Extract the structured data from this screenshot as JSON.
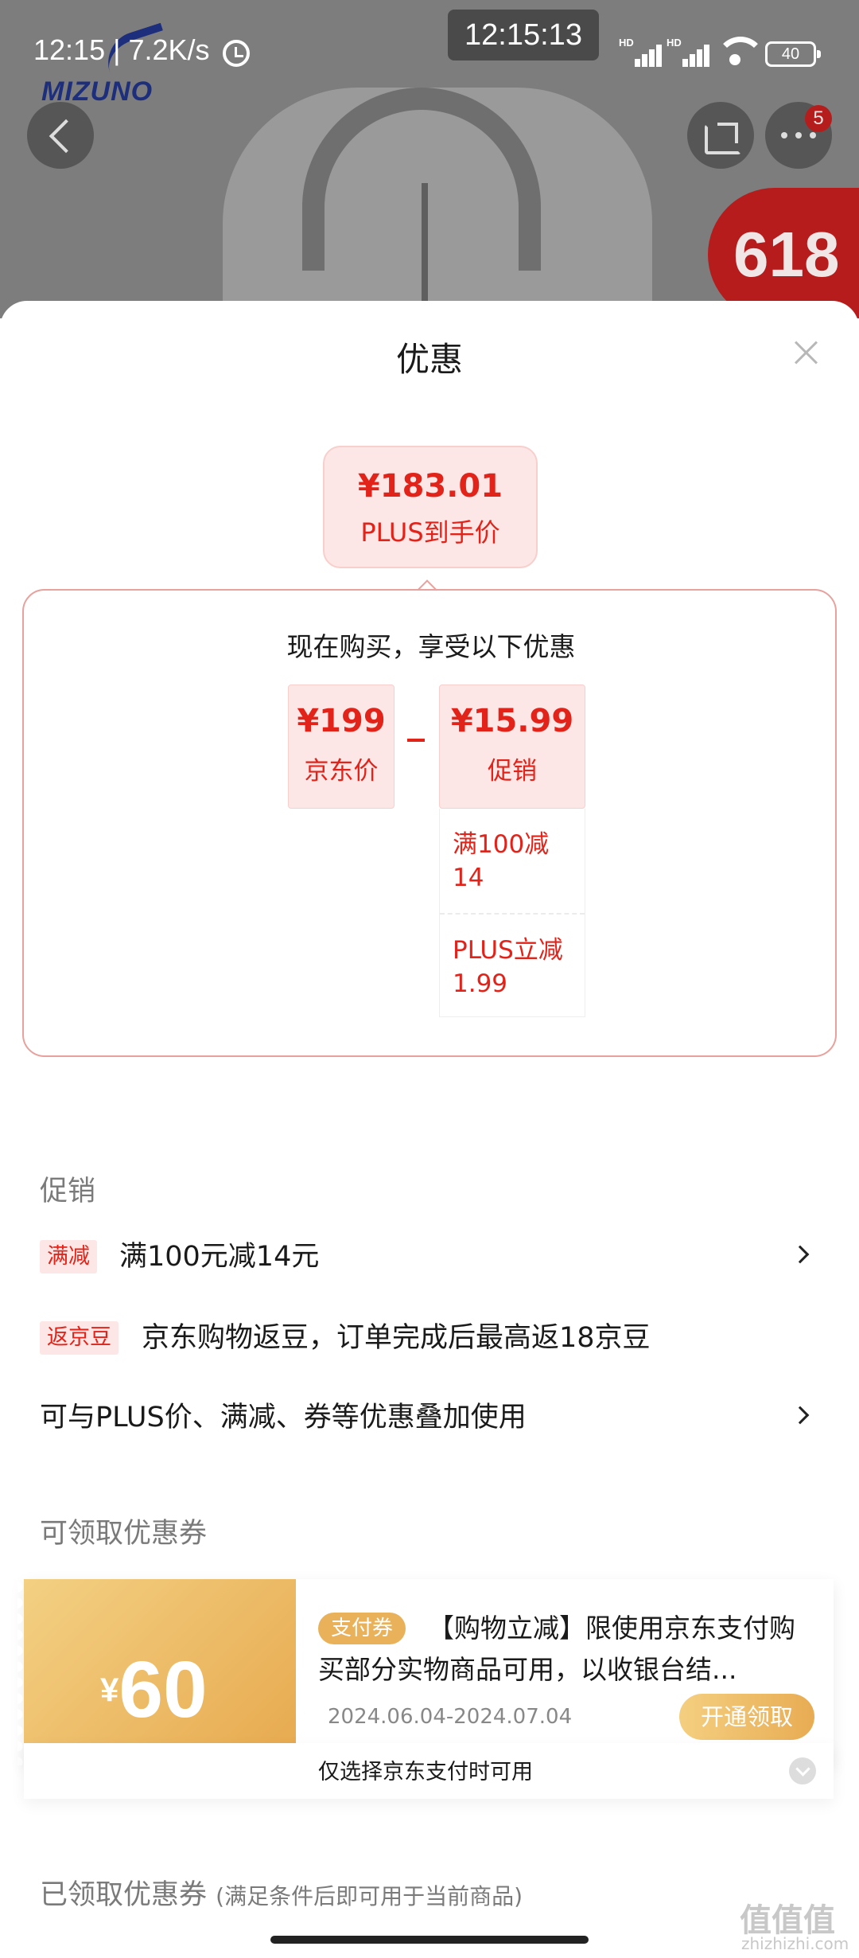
{
  "status_bar": {
    "time": "12:15",
    "speed": "7.2K/s",
    "clock_overlay": "12:15:13",
    "signal_label": "HD",
    "battery": "40"
  },
  "background": {
    "brand": "MIZUNO",
    "sale_badge": "618",
    "notification_count": "5"
  },
  "sheet": {
    "title": "优惠",
    "final_price": "¥183.01",
    "final_price_label": "PLUS到手价",
    "breakdown_heading": "现在购买，享受以下优惠",
    "jd_price": "¥199",
    "jd_price_label": "京东价",
    "promo_price": "¥15.99",
    "promo_price_label": "促销",
    "promo_details": [
      "满100减14",
      "PLUS立减1.99"
    ]
  },
  "promotions": {
    "section_title": "促销",
    "rows": [
      {
        "tag": "满减",
        "text": "满100元减14元"
      },
      {
        "tag": "返京豆",
        "text": "京东购物返豆，订单完成后最高返18京豆"
      },
      {
        "text": "可与PLUS价、满减、券等优惠叠加使用"
      }
    ]
  },
  "coupons": {
    "section_title": "可领取优惠券",
    "items": [
      {
        "currency": "¥",
        "amount": "60",
        "tag": "支付券",
        "description": "【购物立减】限使用京东支付购买部分实物商品可用，以收银台结...",
        "date_range": "2024.06.04-2024.07.04",
        "button": "开通领取",
        "note": "仅选择京东支付时可用"
      }
    ]
  },
  "claimed": {
    "title": "已领取优惠券",
    "subtitle": "(满足条件后即可用于当前商品)"
  },
  "watermark": {
    "text": "值值值",
    "domain": "zhizhizhi.com"
  },
  "colors": {
    "accent_red": "#e2231a",
    "coupon_gold": "#e8ac53"
  }
}
